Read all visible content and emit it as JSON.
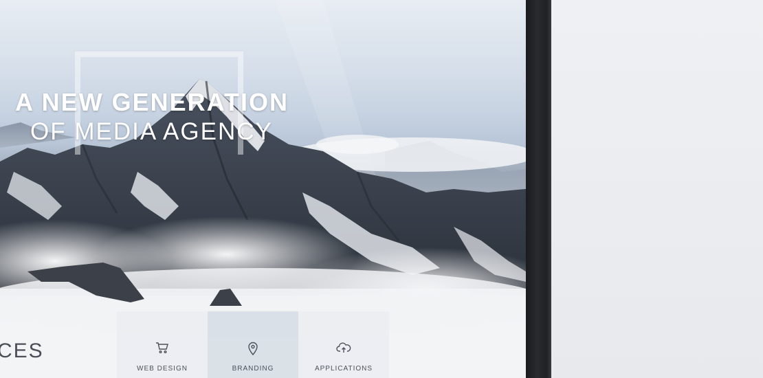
{
  "hero": {
    "title": "A NEW GENERATION",
    "subtitle": "OF MEDIA AGENCY"
  },
  "services": {
    "label": "CES",
    "tiles": [
      {
        "label": "WEB DESIGN",
        "icon": "cart-icon",
        "active": false
      },
      {
        "label": "BRANDING",
        "icon": "map-pin-icon",
        "active": true
      },
      {
        "label": "APPLICATIONS",
        "icon": "cloud-upload-icon",
        "active": false
      }
    ]
  },
  "colors": {
    "sky": "#c7d3e2",
    "bezel": "#1f2022",
    "background": "#eceef2",
    "tile": "#eaedf1",
    "tile_active": "#d8dee5",
    "text_dark": "#4b5159"
  }
}
